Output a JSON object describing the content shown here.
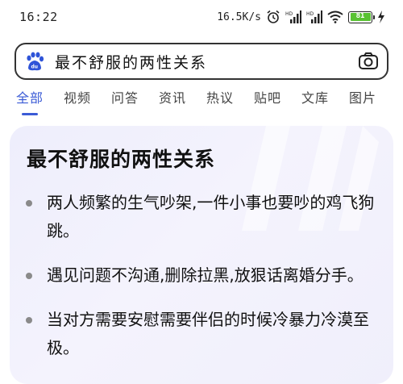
{
  "status_bar": {
    "time": "16:22",
    "network_speed": "16.5K/s",
    "battery_level": "81",
    "battery_color": "#59c232"
  },
  "search": {
    "query": "最不舒服的两性关系",
    "logo_icon": "baidu-paw-icon",
    "camera_icon": "camera-icon"
  },
  "tabs": [
    {
      "label": "全部"
    },
    {
      "label": "视频"
    },
    {
      "label": "问答"
    },
    {
      "label": "资讯"
    },
    {
      "label": "热议"
    },
    {
      "label": "贴吧"
    },
    {
      "label": "文库"
    },
    {
      "label": "图片"
    }
  ],
  "active_tab_color": "#3b5bd6",
  "card": {
    "title": "最不舒服的两性关系",
    "items": [
      {
        "text": "两人频繁的生气吵架,一件小事也要吵的鸡飞狗跳。"
      },
      {
        "text": "遇见问题不沟通,删除拉黑,放狠话离婚分手。"
      },
      {
        "text": "当对方需要安慰需要伴侣的时候冷暴力冷漠至极。"
      }
    ]
  }
}
